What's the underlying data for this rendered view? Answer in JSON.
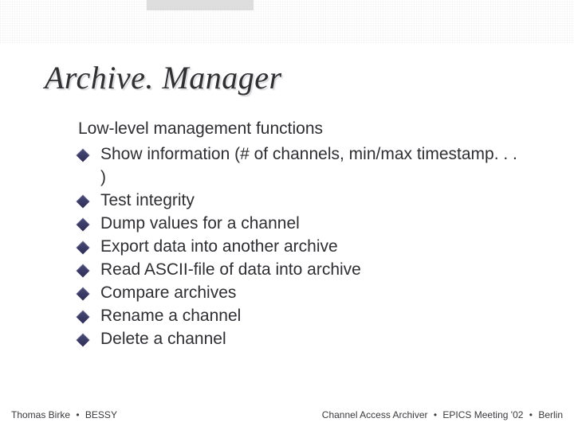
{
  "title": "Archive. Manager",
  "intro": "Low-level management functions",
  "bullets": [
    "Show information (# of channels, min/max timestamp. . . )",
    "Test integrity",
    "Dump values for a channel",
    "Export data into another archive",
    "Read ASCII-file of data into archive",
    "Compare archives",
    "Rename a channel",
    "Delete a channel"
  ],
  "footer": {
    "left_author": "Thomas Birke",
    "left_org": "BESSY",
    "right_app": "Channel Access Archiver",
    "right_event": "EPICS Meeting '02",
    "right_place": "Berlin",
    "separator": "•"
  }
}
